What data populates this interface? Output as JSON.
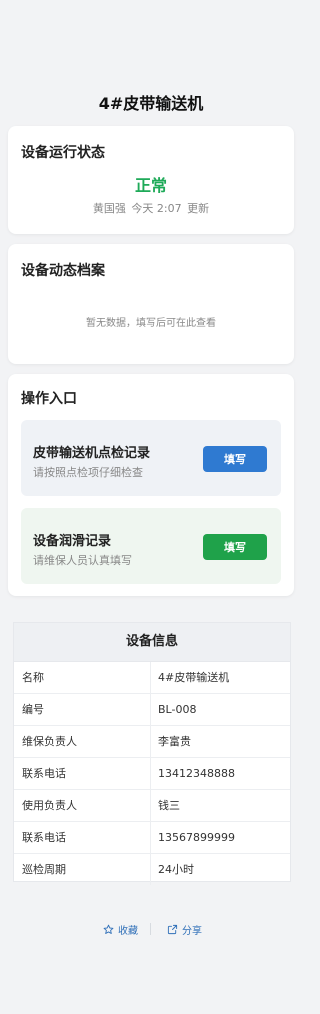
{
  "header": {
    "title": "4#皮带输送机"
  },
  "status_card": {
    "title": "设备运行状态",
    "status": "正常",
    "user": "黄国强",
    "time": "今天 2:07",
    "update_label": "更新"
  },
  "archive_card": {
    "title": "设备动态档案",
    "empty_text": "暂无数据，填写后可在此查看"
  },
  "ops_card": {
    "title": "操作入口",
    "items": [
      {
        "title": "皮带输送机点检记录",
        "subtitle": "请按照点检项仔细检查",
        "button": "填写"
      },
      {
        "title": "设备润滑记录",
        "subtitle": "请维保人员认真填写",
        "button": "填写"
      }
    ]
  },
  "info": {
    "title": "设备信息",
    "rows": [
      {
        "key": "名称",
        "value": "4#皮带输送机"
      },
      {
        "key": "编号",
        "value": "BL-008"
      },
      {
        "key": "维保负责人",
        "value": "李富贵"
      },
      {
        "key": "联系电话",
        "value": "13412348888"
      },
      {
        "key": "使用负责人",
        "value": "钱三"
      },
      {
        "key": "联系电话",
        "value": "13567899999"
      },
      {
        "key": "巡检周期",
        "value": "24小时"
      }
    ]
  },
  "footer": {
    "favorite": "收藏",
    "share": "分享",
    "favorite_icon": "star-outline-icon",
    "share_icon": "share-external-icon"
  },
  "colors": {
    "status_ok": "#1faa59",
    "primary_button": "#2f7ad1",
    "success_button": "#1fa24a",
    "link": "#2f6fb8"
  }
}
